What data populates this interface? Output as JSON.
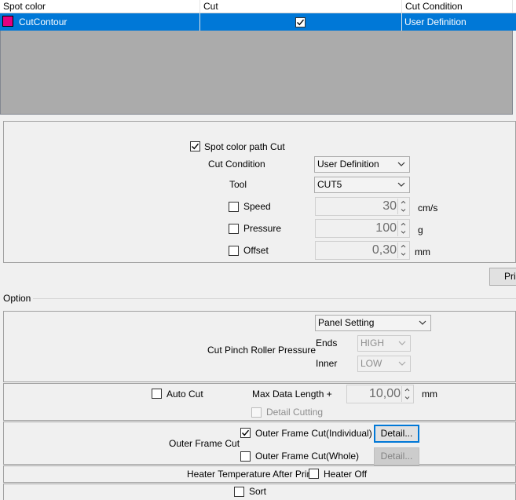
{
  "table": {
    "headers": [
      "Spot color",
      "Cut",
      "Cut Condition"
    ],
    "rows": [
      {
        "spot_color": "CutContour",
        "swatch_color": "#e4007f",
        "cut_checked": true,
        "cut_condition": "User Definition"
      }
    ]
  },
  "spot": {
    "path_cut_label": "Spot color path Cut",
    "path_cut_checked": true,
    "cut_condition_label": "Cut Condition",
    "cut_condition_value": "User Definition",
    "tool_label": "Tool",
    "tool_value": "CUT5",
    "speed_label": "Speed",
    "speed_value": "30",
    "speed_unit": "cm/s",
    "pressure_label": "Pressure",
    "pressure_value": "100",
    "pressure_unit": "g",
    "offset_label": "Offset",
    "offset_value": "0,30",
    "offset_unit": "mm"
  },
  "print_button_label": "Print",
  "option": {
    "label": "Option",
    "pinch": {
      "label": "Cut Pinch Roller Pressure",
      "panel_setting": "Panel Setting",
      "ends_label": "Ends",
      "ends_value": "HIGH",
      "inner_label": "Inner",
      "inner_value": "LOW"
    },
    "auto_cut": {
      "label": "Auto Cut",
      "max_label": "Max Data Length +",
      "max_value": "10,00",
      "max_unit": "mm",
      "detail_cutting": "Detail Cutting"
    },
    "outer_frame": {
      "label": "Outer Frame Cut",
      "individual": "Outer Frame Cut(Individual)",
      "individual_checked": true,
      "whole": "Outer Frame Cut(Whole)",
      "detail_label": "Detail...",
      "detail2_label": "Detail..."
    },
    "heater": {
      "label": "Heater Temperature After Print",
      "off_label": "Heater Off"
    },
    "sort_label": "Sort"
  }
}
